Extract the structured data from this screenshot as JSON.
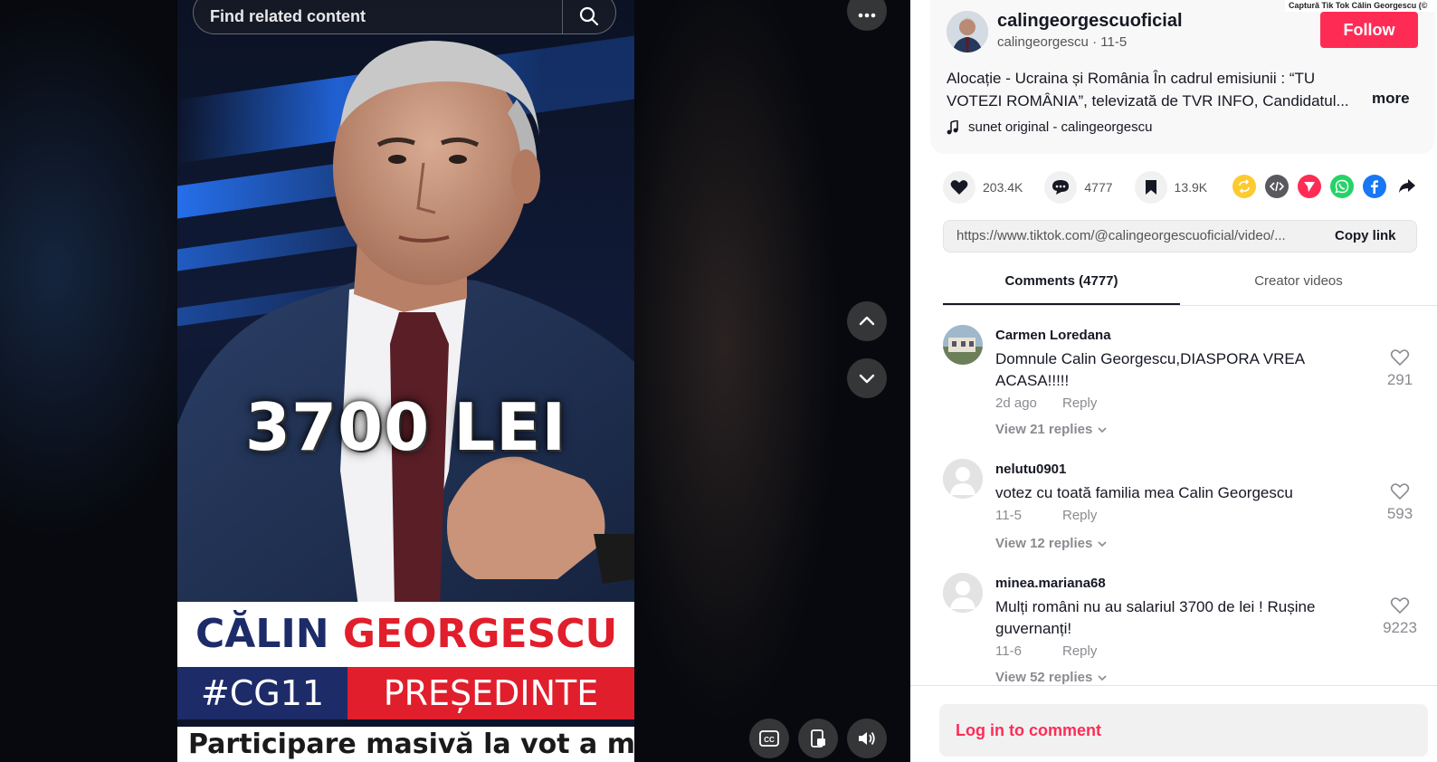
{
  "search": {
    "placeholder": "Find related content"
  },
  "video": {
    "overlay_text": "3700 LEI",
    "name_first": "CĂLIN",
    "name_last": "GEORGESCU",
    "tag": "#CG11",
    "role": "PREȘEDINTE",
    "ticker": "Participare masivă la vot a mol"
  },
  "author": {
    "display_name": "calingeorgescuoficial",
    "handle": "calingeorgescu",
    "date": "11-5",
    "follow_label": "Follow"
  },
  "caption": {
    "text": "Alocație - Ucraina și România În cadrul emisiunii : “TU VOTEZI ROMÂNIA”, televizată de TVR INFO, Candidatul...",
    "more_label": "more",
    "music": "sunet original - calingeorgescu"
  },
  "actions": {
    "likes": "203.4K",
    "comments": "4777",
    "saves": "13.9K",
    "share_icons": [
      "repost-icon",
      "embed-icon",
      "send-icon",
      "whatsapp-icon",
      "facebook-icon",
      "share-arrow-icon"
    ]
  },
  "link": {
    "url": "https://www.tiktok.com/@calingeorgescuoficial/video/...",
    "copy_label": "Copy link"
  },
  "tabs": [
    {
      "label": "Comments (4777)",
      "active": true
    },
    {
      "label": "Creator videos",
      "active": false
    }
  ],
  "comments": [
    {
      "user": "Carmen Loredana",
      "text": "Domnule Calin Georgescu,DIASPORA VREA ACASA!!!!!",
      "time": "2d ago",
      "reply_label": "Reply",
      "replies": "View 21 replies",
      "likes": "291"
    },
    {
      "user": "nelutu0901",
      "text": "votez cu toată familia mea Calin Georgescu",
      "time": "11-5",
      "reply_label": "Reply",
      "replies": "View 12 replies",
      "likes": "593"
    },
    {
      "user": "minea.mariana68",
      "text": "Mulți români nu au salariul 3700 de lei ! Rușine guvernanți!",
      "time": "11-6",
      "reply_label": "Reply",
      "replies": "View 52 replies",
      "likes": "9223"
    }
  ],
  "comment_bar": {
    "login_label": "Log in to comment"
  },
  "credit": "Captură Tik Tok Călin Georgescu (©",
  "colors": {
    "accent": "#fe2c55",
    "navy": "#1d2b69",
    "red": "#e11e2b"
  }
}
